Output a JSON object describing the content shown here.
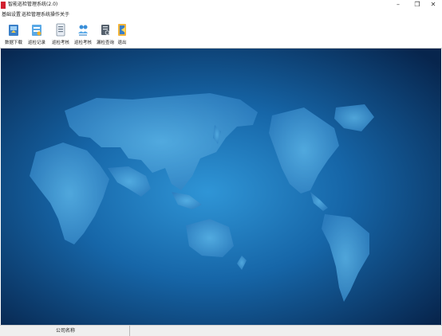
{
  "window": {
    "title": "智能巡检管理系统(2.0)",
    "controls": {
      "minimize": "–",
      "restore": "❐",
      "close": "✕"
    }
  },
  "menu": {
    "items": [
      "基础设置",
      "巡检管理",
      "系统操作",
      "关于"
    ]
  },
  "toolbar": {
    "buttons": [
      {
        "label": "数据下载",
        "icon": "download-icon"
      },
      {
        "label": "巡检记录",
        "icon": "record-icon"
      },
      {
        "label": "巡检考核",
        "icon": "assessment-icon"
      },
      {
        "label": "巡检考核",
        "icon": "users-icon"
      },
      {
        "label": "漏检查询",
        "icon": "query-icon"
      },
      {
        "label": "退出",
        "icon": "exit-icon"
      }
    ]
  },
  "main": {
    "background": "world-map",
    "colors": {
      "center": "#2a8ed0",
      "edge": "#082a55",
      "land": "#4aa3da"
    }
  },
  "status": {
    "company_label": "公司名称"
  }
}
